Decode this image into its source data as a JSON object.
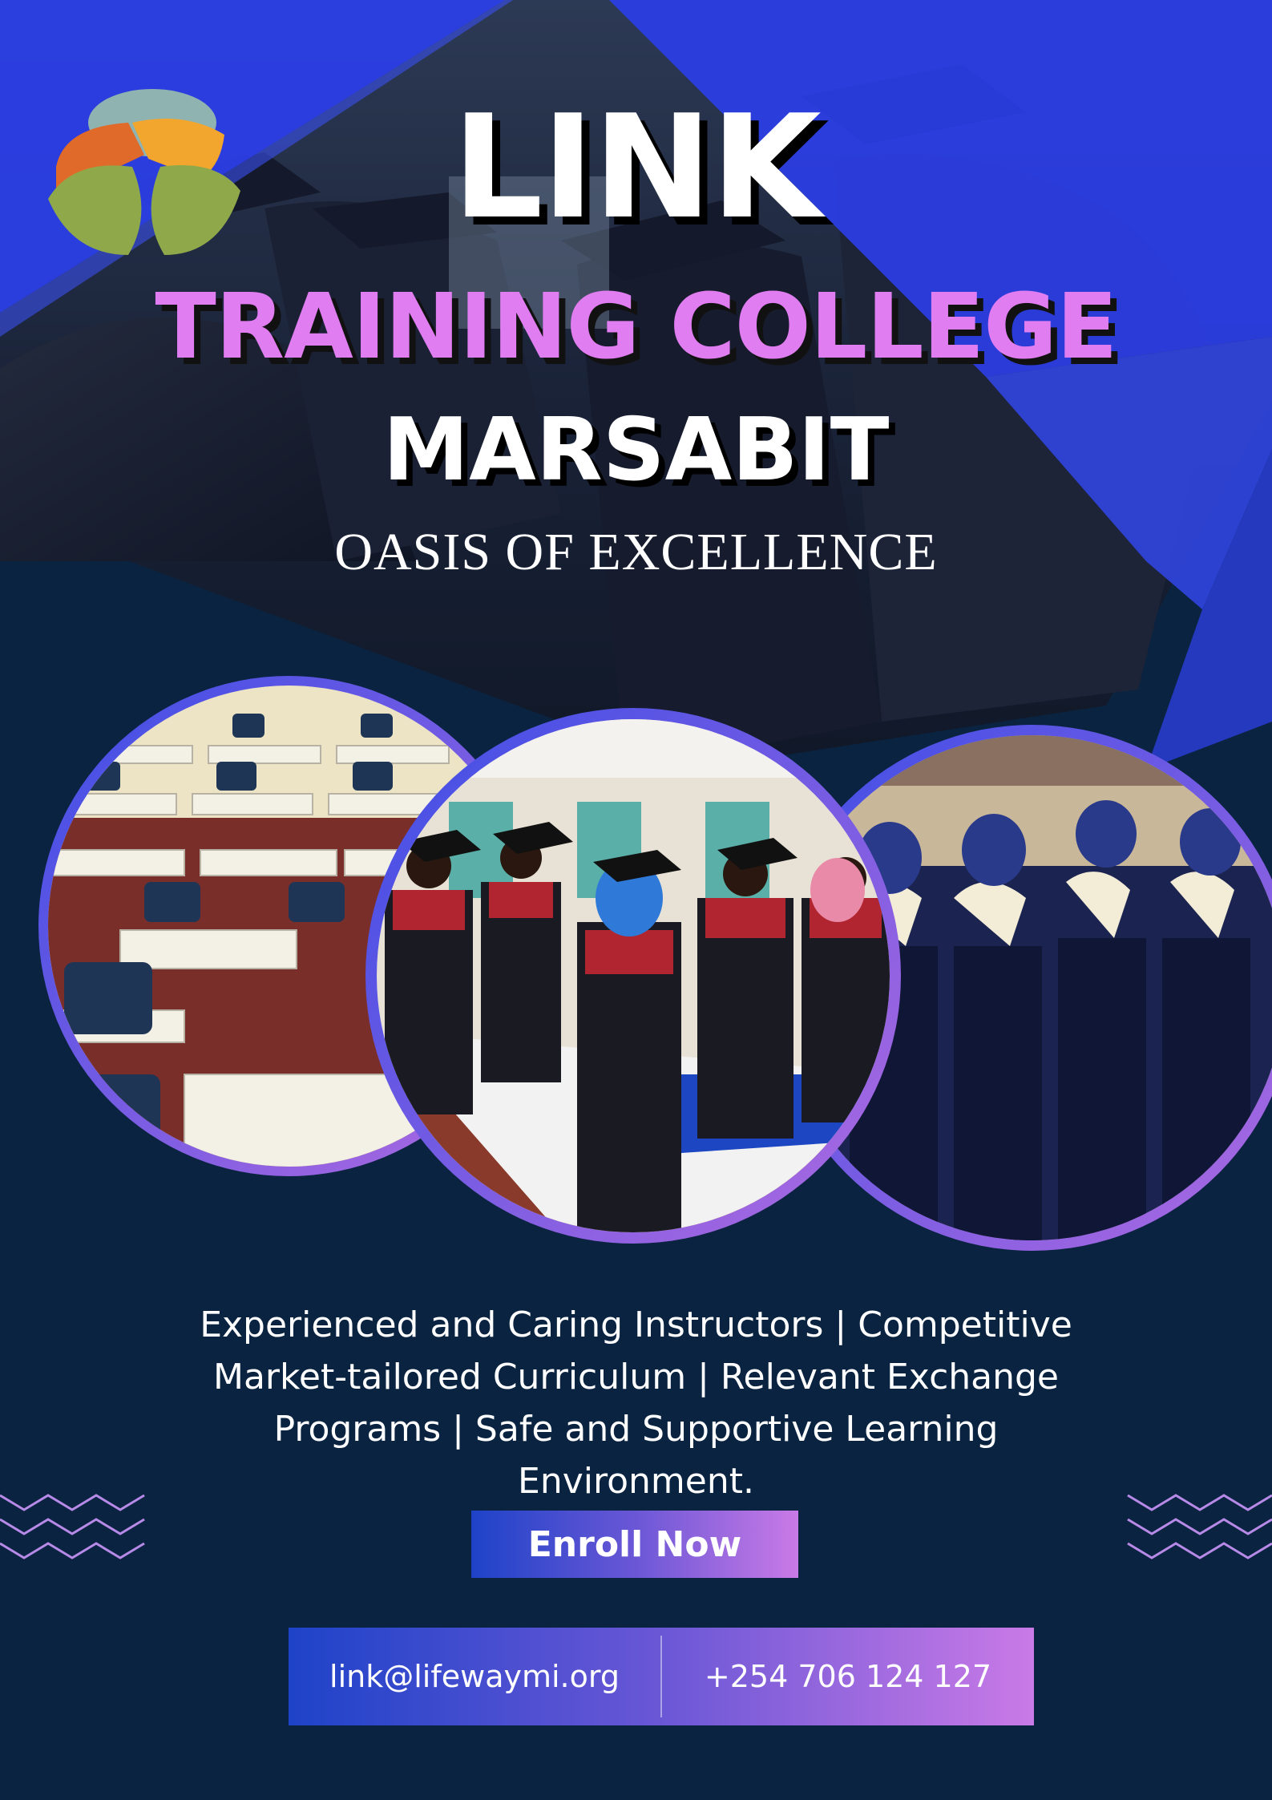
{
  "header": {
    "title_line1": "LINK",
    "title_line2": "TRAINING COLLEGE",
    "title_line3": "MARSABIT",
    "tagline": "OASIS OF EXCELLENCE"
  },
  "description": "Experienced and Caring Instructors | Competitive Market-tailored Curriculum | Relevant Exchange Programs | Safe and Supportive Learning Environment.",
  "cta": {
    "label": "Enroll Now"
  },
  "contact": {
    "email": "link@lifewaymi.org",
    "phone": "+254 706 124 127"
  },
  "colors": {
    "background": "#0a2340",
    "accent_blue": "#2b3ee6",
    "accent_pink": "#e07df0",
    "gradient_start": "#1e43c8",
    "gradient_end": "#c97ae6"
  },
  "icons": {
    "logo": "leaf-petal-logo-icon",
    "decoration": "zigzag-lines-icon"
  }
}
